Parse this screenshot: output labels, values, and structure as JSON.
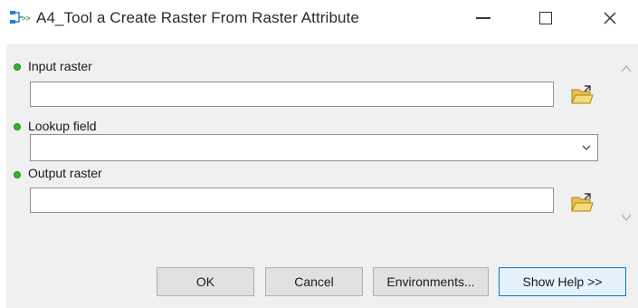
{
  "window": {
    "title": "A4_Tool a Create Raster From Raster Attribute",
    "icon": "model-tool-icon"
  },
  "params": [
    {
      "label": "Input raster",
      "value": "",
      "control": "text-with-browse",
      "required": true
    },
    {
      "label": "Lookup field",
      "value": "",
      "control": "dropdown",
      "required": true
    },
    {
      "label": "Output raster",
      "value": "",
      "control": "text-with-browse",
      "required": true
    }
  ],
  "buttons": {
    "ok": "OK",
    "cancel": "Cancel",
    "environments": "Environments...",
    "show_help": "Show Help >>"
  },
  "colors": {
    "required_bullet": "#2fb52f",
    "panel_bg": "#f0f0f0",
    "focus_border": "#0078d7"
  }
}
